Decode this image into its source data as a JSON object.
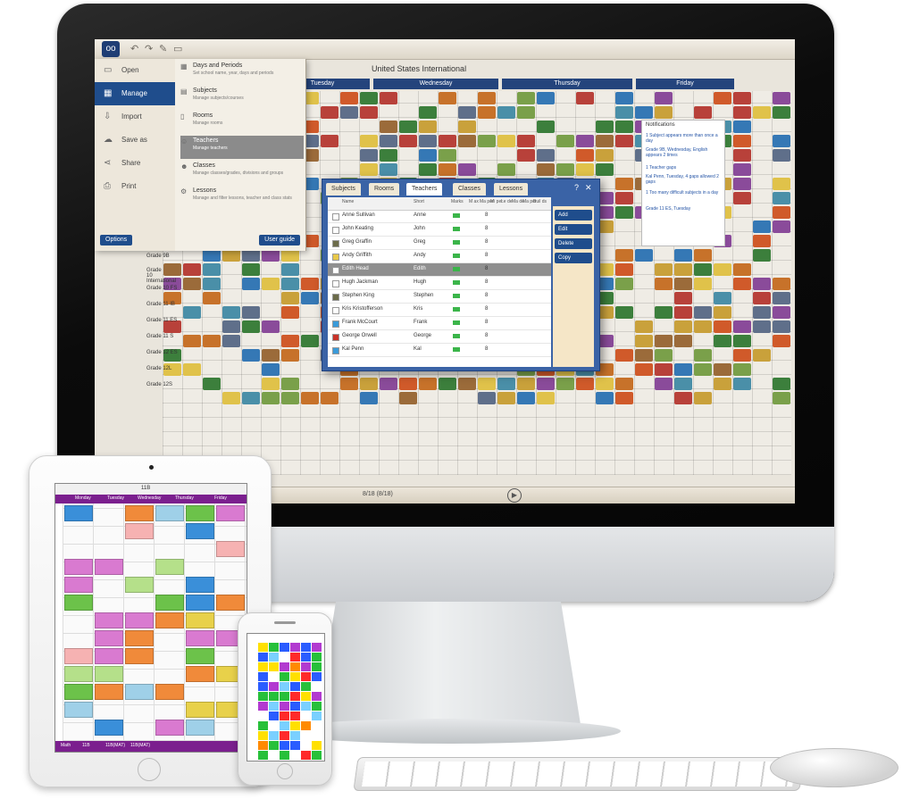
{
  "imac": {
    "app_title": "United States International",
    "days": [
      "Tuesday",
      "Wednesday",
      "Thursday",
      "Friday"
    ],
    "rows": [
      "Grade 9B",
      "Grade 10 International",
      "Grade 10 FS",
      "Grade 11 IB",
      "Grade 11 ES",
      "Grade 11 S",
      "Grade 12 ES",
      "Grade 12L",
      "Grade 12S"
    ],
    "menu": {
      "items": [
        {
          "label": "Open",
          "icon": "folder-icon"
        },
        {
          "label": "Manage",
          "icon": "grid-icon",
          "active": true
        },
        {
          "label": "Import",
          "icon": "import-icon"
        },
        {
          "label": "Save as",
          "icon": "save-icon"
        },
        {
          "label": "Share",
          "icon": "share-icon"
        },
        {
          "label": "Print",
          "icon": "print-icon"
        }
      ],
      "sub_items": [
        {
          "title": "Days and Periods",
          "desc": "Set school name, year, days and periods"
        },
        {
          "title": "Subjects",
          "desc": "Manage subjects/courses"
        },
        {
          "title": "Rooms",
          "desc": "Manage rooms"
        },
        {
          "title": "Teachers",
          "desc": "Manage teachers",
          "active": true
        },
        {
          "title": "Classes",
          "desc": "Manage classes/grades, divisions and groups"
        },
        {
          "title": "Lessons",
          "desc": "Manage and filter lessons, teacher and class stats"
        }
      ],
      "options": "Options",
      "user_guide": "User guide"
    },
    "dialog": {
      "tabs": [
        "Subjects",
        "Rooms",
        "Teachers",
        "Classes",
        "Lessons"
      ],
      "help": "?",
      "close": "✕",
      "headers": [
        "Name",
        "Short",
        "Marks",
        "M ax",
        "Ma per",
        "Mi per",
        "Le de",
        "Ma de",
        "Ma per",
        "Buil ds"
      ],
      "teachers": [
        {
          "name": "Anne Sullivan",
          "short": "Anne",
          "color": "#ffffff",
          "num": "8"
        },
        {
          "name": "John Keating",
          "short": "John",
          "color": "#ffffff",
          "num": "8"
        },
        {
          "name": "Greg Graffin",
          "short": "Greg",
          "color": "#6b6b4a",
          "num": "8"
        },
        {
          "name": "Andy Griffith",
          "short": "Andy",
          "color": "#e8c84a",
          "num": "8"
        },
        {
          "name": "Edith Head",
          "short": "Edith",
          "color": "#ffffff",
          "num": "8",
          "selected": true
        },
        {
          "name": "Hugh Jackman",
          "short": "Hugh",
          "color": "#ffffff",
          "num": "8"
        },
        {
          "name": "Stephen King",
          "short": "Stephen",
          "color": "#6b6b4a",
          "num": "8"
        },
        {
          "name": "Kris Kristofferson",
          "short": "Kris",
          "color": "#ffffff",
          "num": "8"
        },
        {
          "name": "Frank McCourt",
          "short": "Frank",
          "color": "#3a9ad9",
          "num": "8"
        },
        {
          "name": "George Orwell",
          "short": "George",
          "color": "#c8342a",
          "num": "8"
        },
        {
          "name": "Kal Penn",
          "short": "Kal",
          "color": "#3a9ad9",
          "num": "8"
        }
      ],
      "buttons": [
        "Add",
        "Edit",
        "Delete",
        "Copy"
      ]
    },
    "notifications": {
      "title": "Notifications",
      "items": [
        "1 Subject appears more than once a day",
        "Grade 9B, Wednesday, English appears 2 times",
        "1 Teacher gaps",
        "Kal Penn, Tuesday, 4 gaps allowed 2 gaps",
        "1 Too many difficult subjects in a day",
        "Grade 11 ES, Tuesday"
      ]
    },
    "status": "8/18 (8/18)"
  },
  "ipad": {
    "toolbar_number": "11B",
    "days": [
      "Monday",
      "Tuesday",
      "Wednesday",
      "Thursday",
      "Friday"
    ],
    "bottom": [
      "Math",
      "11B",
      "11B(MAT)",
      "11B(MAT)"
    ]
  },
  "colors": {
    "dialog_blue": "#3a63a6",
    "menu_active": "#1f4d8c",
    "ipad_accent": "#7b1f8e"
  }
}
